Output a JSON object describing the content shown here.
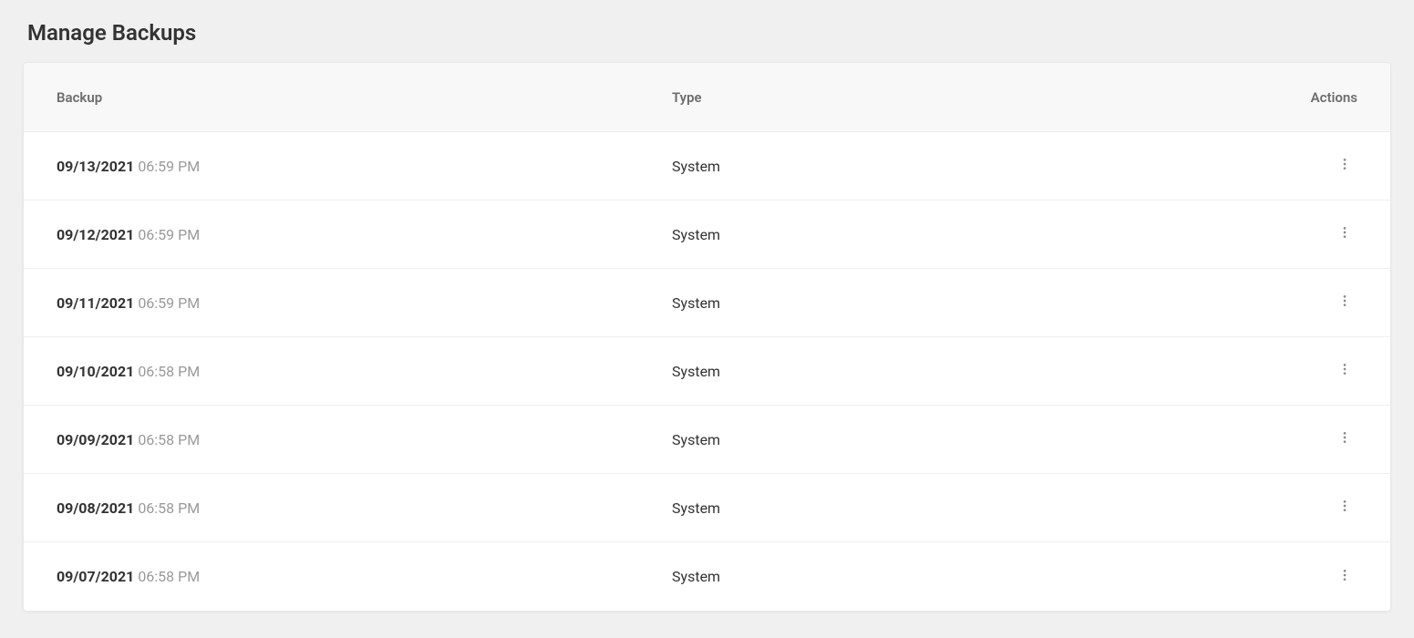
{
  "page": {
    "title": "Manage Backups"
  },
  "table": {
    "headers": {
      "backup": "Backup",
      "type": "Type",
      "actions": "Actions"
    },
    "rows": [
      {
        "date": "09/13/2021",
        "time": "06:59 PM",
        "type": "System"
      },
      {
        "date": "09/12/2021",
        "time": "06:59 PM",
        "type": "System"
      },
      {
        "date": "09/11/2021",
        "time": "06:59 PM",
        "type": "System"
      },
      {
        "date": "09/10/2021",
        "time": "06:58 PM",
        "type": "System"
      },
      {
        "date": "09/09/2021",
        "time": "06:58 PM",
        "type": "System"
      },
      {
        "date": "09/08/2021",
        "time": "06:58 PM",
        "type": "System"
      },
      {
        "date": "09/07/2021",
        "time": "06:58 PM",
        "type": "System"
      }
    ]
  }
}
